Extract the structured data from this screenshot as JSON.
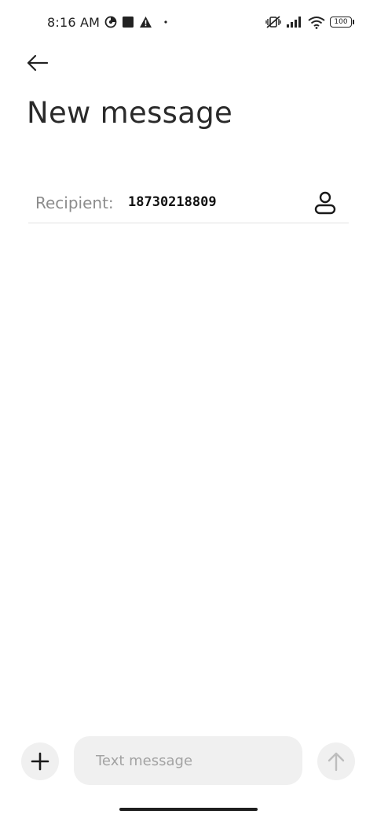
{
  "status_bar": {
    "time": "8:16 AM",
    "left_icons": [
      "data-saver-icon",
      "stop-icon",
      "warning-icon",
      "dot-icon"
    ],
    "right_icons": [
      "vibrate-muted-icon",
      "signal-icon",
      "wifi-icon",
      "battery-icon"
    ],
    "battery_level": "100"
  },
  "header": {
    "back_icon": "arrow-left-icon",
    "title": "New message"
  },
  "recipient": {
    "label": "Recipient:",
    "value": "18730218809",
    "contact_icon": "person-icon"
  },
  "composer": {
    "attach_icon": "plus-icon",
    "placeholder": "Text message",
    "send_icon": "arrow-up-icon",
    "send_enabled": false
  },
  "colors": {
    "background": "#ffffff",
    "input_bg": "#f0f0f0",
    "placeholder": "#a3a3a3",
    "label": "#8c8c8c",
    "text": "#1f1f1f"
  }
}
